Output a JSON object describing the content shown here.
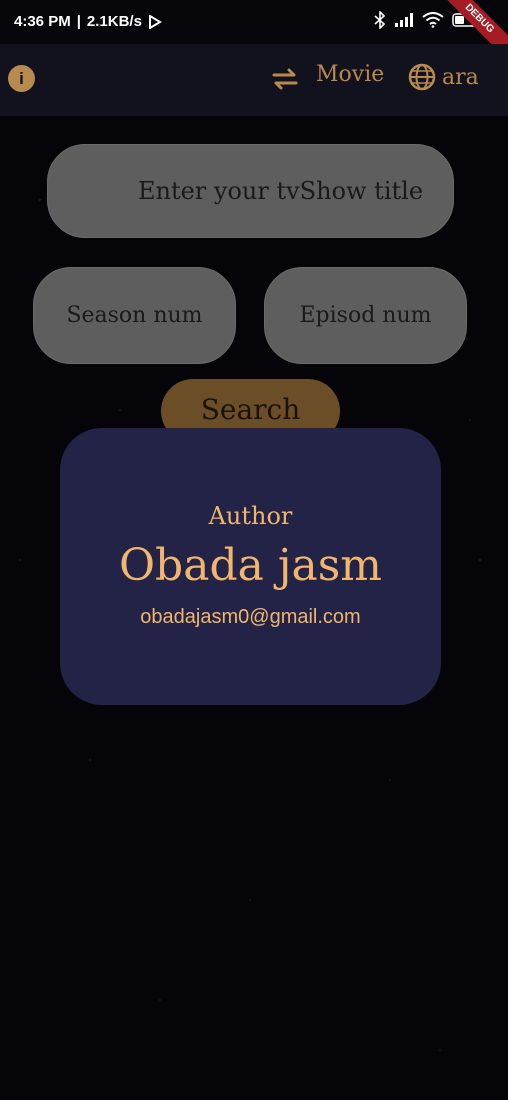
{
  "status_bar": {
    "time": "4:36 PM",
    "speed": "2.1KB/s",
    "battery": "42",
    "debug_banner": "DEBUG"
  },
  "app_bar": {
    "mode_label": "Movie",
    "language_label": "ara",
    "icons": [
      "info-icon",
      "swap-icon",
      "globe-icon"
    ],
    "accent_color": "#b78a4f"
  },
  "form": {
    "title_placeholder": "Enter your tvShow title",
    "season_placeholder": "Season num",
    "episode_placeholder": "Episod num",
    "search_label": "Search"
  },
  "author_card": {
    "label": "Author",
    "name": "Obada jasm",
    "email": "obadajasm0@gmail.com",
    "card_color": "#222346",
    "text_color": "#f1b56d"
  }
}
